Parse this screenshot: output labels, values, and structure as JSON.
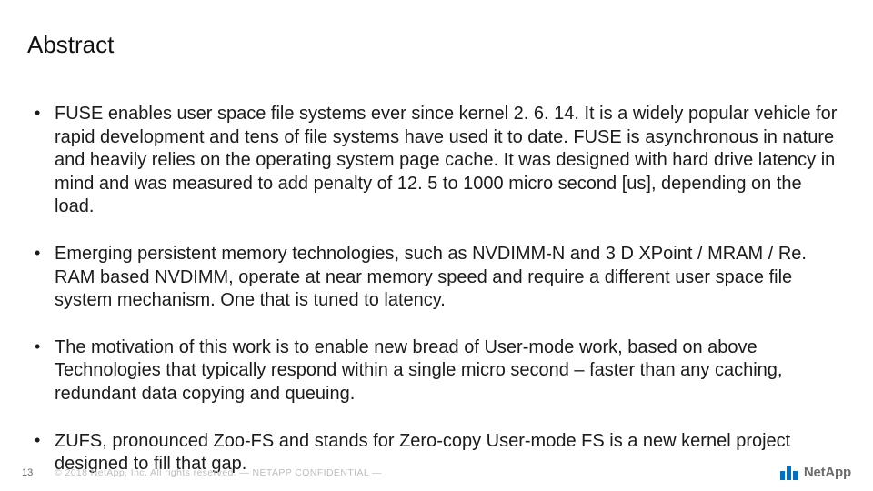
{
  "slide": {
    "title": "Abstract",
    "bullets": [
      "FUSE enables user space file systems ever since kernel 2. 6. 14. It is a widely popular vehicle for rapid development and tens of file systems have used it to date. FUSE is asynchronous in nature and heavily relies on the operating system page cache. It was designed with hard drive latency in mind and was measured to add penalty of 12. 5 to 1000 micro second [us], depending on the load.",
      "Emerging persistent memory technologies, such as NVDIMM-N and 3 D XPoint / MRAM / Re. RAM based NVDIMM, operate at near memory speed and require a different user space file system mechanism. One that is tuned to latency.",
      "The motivation of this work is to enable new bread of User-mode work, based on above Technologies that typically respond within a single micro second – faster than any caching, redundant data copying and queuing.",
      "ZUFS, pronounced Zoo-FS and stands for Zero-copy User-mode FS is a new kernel project designed to fill that gap."
    ]
  },
  "footer": {
    "page_number": "13",
    "copyright": "© 2018 NetApp, Inc. All rights reserved.  — NETAPP CONFIDENTIAL —",
    "logo_text": "NetApp"
  }
}
